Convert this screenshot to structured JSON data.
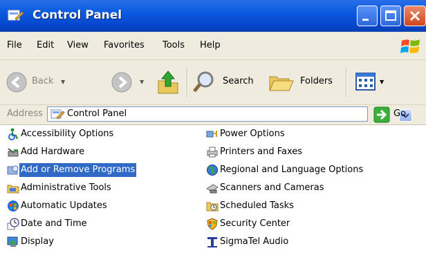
{
  "window": {
    "title": "Control Panel"
  },
  "menu": [
    "File",
    "Edit",
    "View",
    "Favorites",
    "Tools",
    "Help"
  ],
  "toolbar": {
    "back_label": "Back",
    "search_label": "Search",
    "folders_label": "Folders"
  },
  "address": {
    "label": "Address",
    "value": "Control Panel",
    "go_label": "Go"
  },
  "items_left": [
    {
      "label": "Accessibility Options",
      "icon": "accessibility-icon"
    },
    {
      "label": "Add Hardware",
      "icon": "add-hardware-icon"
    },
    {
      "label": "Add or Remove Programs",
      "icon": "add-remove-programs-icon",
      "selected": true
    },
    {
      "label": "Administrative Tools",
      "icon": "administrative-tools-icon"
    },
    {
      "label": "Automatic Updates",
      "icon": "automatic-updates-icon"
    },
    {
      "label": "Date and Time",
      "icon": "date-time-icon"
    },
    {
      "label": "Display",
      "icon": "display-icon"
    }
  ],
  "items_right": [
    {
      "label": "Power Options",
      "icon": "power-options-icon"
    },
    {
      "label": "Printers and Faxes",
      "icon": "printers-faxes-icon"
    },
    {
      "label": "Regional and Language Options",
      "icon": "regional-language-icon"
    },
    {
      "label": "Scanners and Cameras",
      "icon": "scanners-cameras-icon"
    },
    {
      "label": "Scheduled Tasks",
      "icon": "scheduled-tasks-icon"
    },
    {
      "label": "Security Center",
      "icon": "security-center-icon"
    },
    {
      "label": "SigmaTel Audio",
      "icon": "sigmatel-audio-icon"
    }
  ],
  "colors": {
    "titlebar": "#0a5ae0",
    "selection": "#316ac5",
    "chrome": "#efebde"
  }
}
